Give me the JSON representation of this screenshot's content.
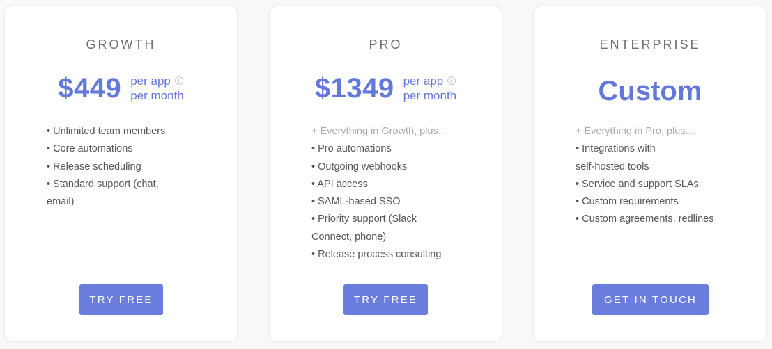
{
  "colors": {
    "accent": "#6478dc",
    "button": "#6a7ddd",
    "tier": "#6f6f6f",
    "text": "#555555",
    "muted": "#a9a9a9"
  },
  "plans": [
    {
      "name": "GROWTH",
      "price": "$449",
      "per_line1": "per app",
      "per_line2": "per month",
      "info_icon": "info-circle-icon",
      "features": [
        "• Unlimited team members",
        "• Core automations",
        "• Release scheduling",
        "• Standard support (chat,",
        "email)"
      ],
      "button": "TRY FREE"
    },
    {
      "name": "PRO",
      "price": "$1349",
      "per_line1": "per app",
      "per_line2": "per month",
      "info_icon": "info-circle-icon",
      "intro": "+ Everything in Growth, plus...",
      "features": [
        "• Pro automations",
        "• Outgoing webhooks",
        "• API access",
        "• SAML-based SSO",
        "• Priority support (Slack",
        "Connect, phone)",
        "• Release process consulting"
      ],
      "button": "TRY FREE"
    },
    {
      "name": "ENTERPRISE",
      "price": "Custom",
      "intro": "+ Everything in Pro, plus...",
      "features": [
        "• Integrations with",
        "self-hosted tools",
        "• Service and support SLAs",
        "• Custom requirements",
        "• Custom agreements, redlines"
      ],
      "button": "GET IN TOUCH"
    }
  ]
}
